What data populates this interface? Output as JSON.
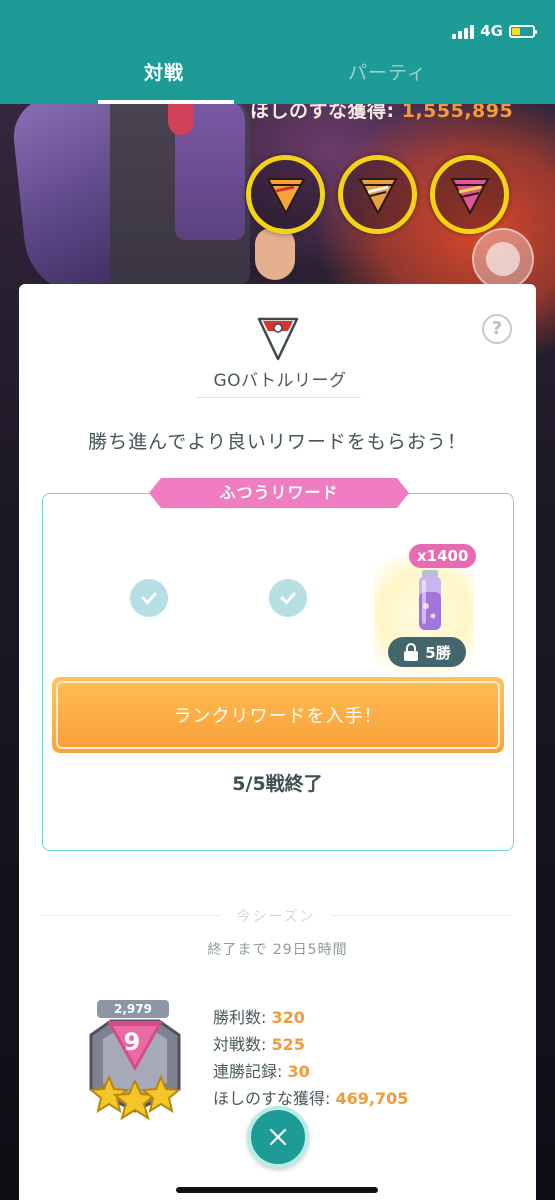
{
  "status_bar": {
    "network": "4G"
  },
  "tabs": {
    "battle": "対戦",
    "party": "パーティ"
  },
  "background": {
    "stardust_label": "ほしのすな獲得:",
    "stardust_value": "1,555,895"
  },
  "league": {
    "name": "GOバトルリーグ",
    "headline": "勝ち進んでより良いリワードをもらおう！",
    "help": "?"
  },
  "rewards": {
    "ribbon": "ふつうリワード",
    "item_quantity": "x1400",
    "lock_label": "5勝",
    "claim_button": "ランクリワードを入手！",
    "battles_done": "5/5戦終了"
  },
  "season": {
    "label": "今シーズン",
    "ends_in": "終了まで 29日5時間",
    "rating": "2,979",
    "rank": "9",
    "stats": [
      {
        "label": "勝利数:",
        "value": "320"
      },
      {
        "label": "対戦数:",
        "value": "525"
      },
      {
        "label": "連勝記録:",
        "value": "30"
      },
      {
        "label": "ほしのすな獲得:",
        "value": "469,705"
      }
    ]
  },
  "colors": {
    "header_teal": "#1d9b96",
    "accent_pink": "#f07cc1",
    "button_orange": "#f9a43b",
    "value_orange": "#f39a3b"
  },
  "icons": {
    "help": "question-icon",
    "check": "check-icon",
    "lock": "lock-icon",
    "close": "close-icon",
    "potion": "potion-icon",
    "league": "great-league-icon"
  }
}
